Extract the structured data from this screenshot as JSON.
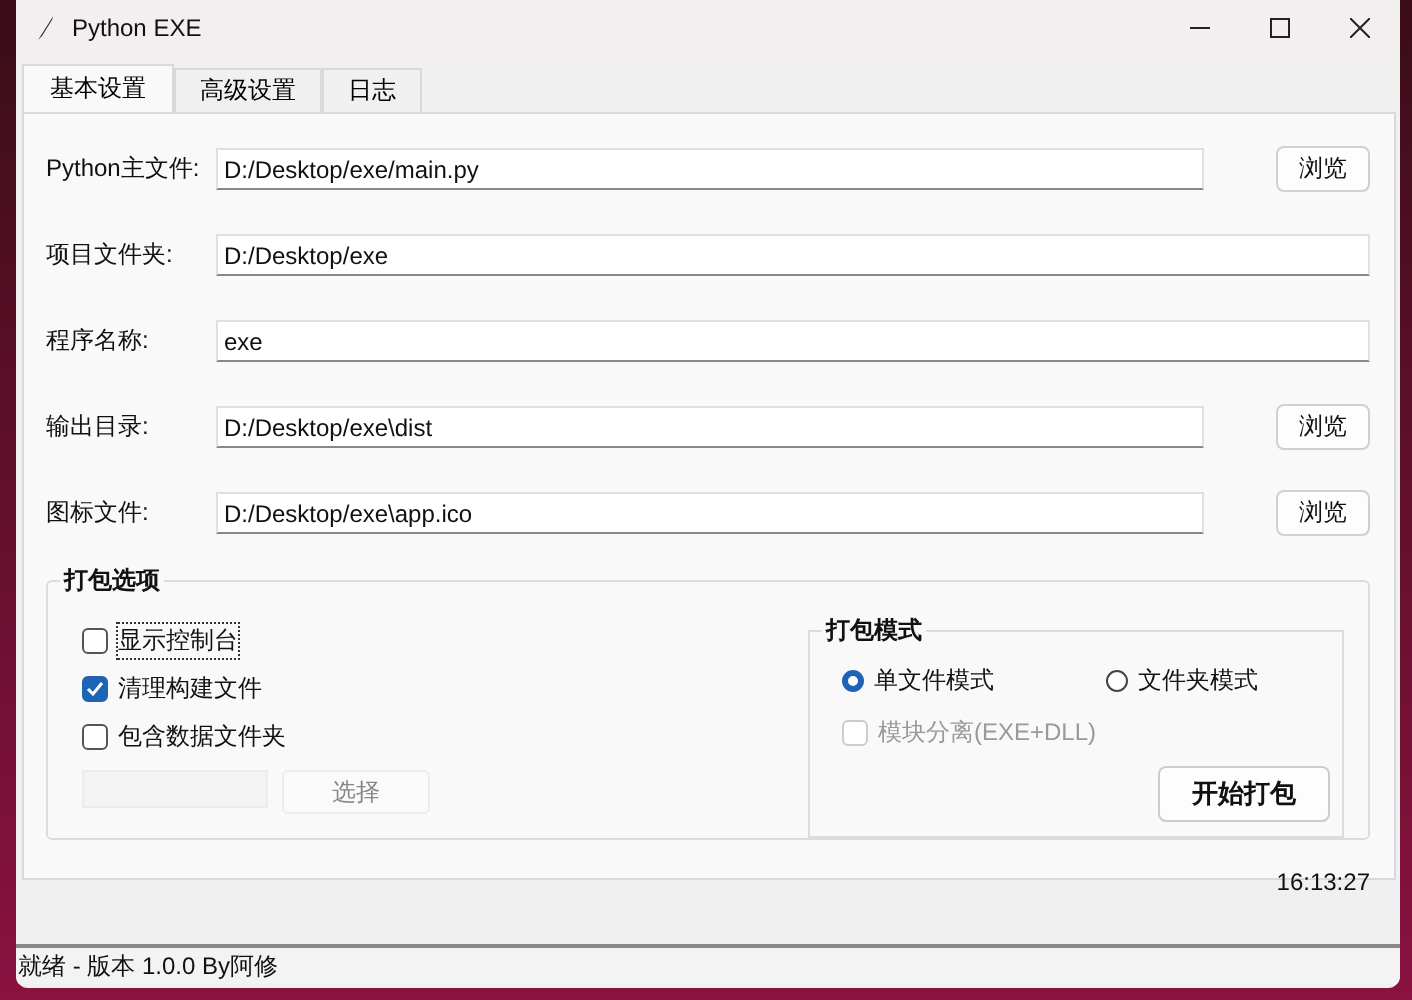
{
  "window": {
    "title": "Python EXE"
  },
  "tabs": [
    {
      "label": "基本设置",
      "selected": true
    },
    {
      "label": "高级设置",
      "selected": false
    },
    {
      "label": "日志",
      "selected": false
    }
  ],
  "fields": [
    {
      "label": "Python主文件:",
      "value": "D:/Desktop/exe/main.py",
      "button": "浏览"
    },
    {
      "label": "项目文件夹:",
      "value": "D:/Desktop/exe"
    },
    {
      "label": "程序名称:",
      "value": "exe"
    },
    {
      "label": "输出目录:",
      "value": "D:/Desktop/exe\\dist",
      "button": "浏览"
    },
    {
      "label": "图标文件:",
      "value": "D:/Desktop/exe\\app.ico",
      "button": "浏览"
    }
  ],
  "options_group": {
    "title": "打包选项",
    "checkboxes": [
      {
        "label": "显示控制台",
        "checked": false,
        "focused": true
      },
      {
        "label": "清理构建文件",
        "checked": true,
        "focused": false
      },
      {
        "label": "包含数据文件夹",
        "checked": false,
        "focused": false
      }
    ],
    "data_folder": {
      "disabled": true,
      "button": "选择"
    }
  },
  "mode_group": {
    "title": "打包模式",
    "radios": [
      {
        "label": "单文件模式",
        "selected": true
      },
      {
        "label": "文件夹模式",
        "selected": false
      }
    ],
    "split_checkbox": {
      "label": "模块分离(EXE+DLL)",
      "checked": false,
      "disabled": true
    }
  },
  "build_button": "开始打包",
  "time": "16:13:27",
  "status_bar": "就绪 - 版本 1.0.0 By阿修"
}
